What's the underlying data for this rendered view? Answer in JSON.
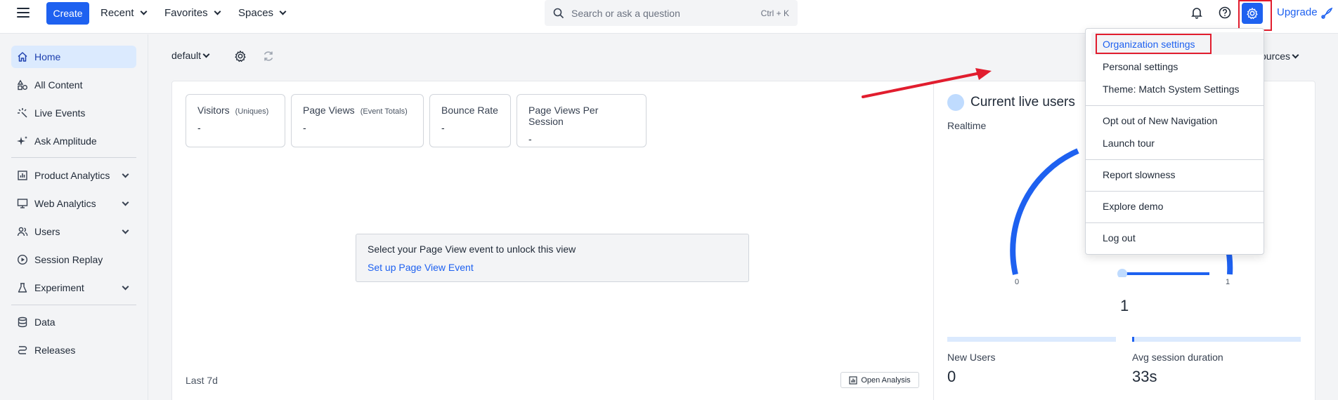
{
  "topbar": {
    "create_label": "Create",
    "recent_label": "Recent",
    "favorites_label": "Favorites",
    "spaces_label": "Spaces",
    "search_placeholder": "Search or ask a question",
    "search_shortcut": "Ctrl + K",
    "upgrade_label": "Upgrade"
  },
  "sidebar": {
    "items": [
      {
        "label": "Home",
        "icon": "home-icon"
      },
      {
        "label": "All Content",
        "icon": "shapes-icon"
      },
      {
        "label": "Live Events",
        "icon": "live-icon"
      },
      {
        "label": "Ask Amplitude",
        "icon": "sparkle-icon"
      },
      {
        "label": "Product Analytics",
        "icon": "chart-icon"
      },
      {
        "label": "Web Analytics",
        "icon": "monitor-icon"
      },
      {
        "label": "Users",
        "icon": "users-icon"
      },
      {
        "label": "Session Replay",
        "icon": "play-icon"
      },
      {
        "label": "Experiment",
        "icon": "flask-icon"
      },
      {
        "label": "Data",
        "icon": "database-icon"
      },
      {
        "label": "Releases",
        "icon": "releases-icon"
      }
    ]
  },
  "toolbar": {
    "space_name": "default",
    "sources_label": "ources"
  },
  "metrics": [
    {
      "label": "Visitors",
      "sub": "(Uniques)",
      "value": "-"
    },
    {
      "label": "Page Views",
      "sub": "(Event Totals)",
      "value": "-"
    },
    {
      "label": "Bounce Rate",
      "sub": "",
      "value": "-"
    },
    {
      "label": "Page Views Per Session",
      "sub": "",
      "value": "-"
    }
  ],
  "unlock": {
    "message": "Select your Page View event to unlock this view",
    "link": "Set up Page View Event"
  },
  "footer": {
    "range": "Last 7d",
    "open_analysis": "Open Analysis"
  },
  "live": {
    "title": "Current live users",
    "subtitle": "Realtime",
    "gauge_min": "0",
    "gauge_max": "1",
    "current": "1",
    "new_users_label": "New Users",
    "new_users_value": "0",
    "avg_session_label": "Avg session duration",
    "avg_session_value": "33s"
  },
  "menu": {
    "items": [
      "Organization settings",
      "Personal settings",
      "Theme: Match System Settings",
      "Opt out of New Navigation",
      "Launch tour",
      "Report slowness",
      "Explore demo",
      "Log out"
    ]
  },
  "colors": {
    "accent": "#1e61f0",
    "annotation_red": "#e11d2e",
    "active_bg": "#dbeafe"
  }
}
